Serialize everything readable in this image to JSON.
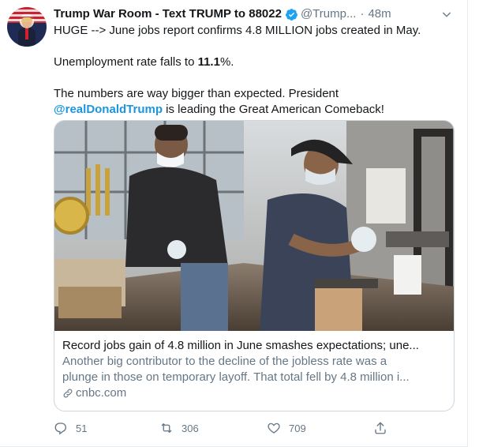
{
  "author": {
    "name": "Trump War Room - Text TRUMP to 88022",
    "handle": "@Trump...",
    "separator": "·",
    "time": "48m"
  },
  "tweet": {
    "line1": "HUGE --> June jobs report confirms 4.8 MILLION jobs created in May.",
    "line2_pre": "Unemployment rate falls to ",
    "line2_bold": "11.1",
    "line2_post": "%.",
    "line3": "The numbers are way bigger than expected. President",
    "line4_mention": "@realDonaldTrump",
    "line4_post": " is leading the Great American Comeback!"
  },
  "card": {
    "title": "Record jobs gain of 4.8 million in June smashes expectations; une...",
    "desc_line1": "Another big contributor to the decline of the jobless rate was a",
    "desc_line2": "plunge in those on temporary layoff. That total fell by 4.8 million i...",
    "domain": "cnbc.com"
  },
  "actions": {
    "replies": "51",
    "retweets": "306",
    "likes": "709"
  },
  "icons": {
    "verified": "verified-badge-icon",
    "more": "chevron-down-icon",
    "reply": "reply-icon",
    "retweet": "retweet-icon",
    "like": "heart-icon",
    "share": "share-icon",
    "link": "link-icon"
  },
  "colors": {
    "link_blue": "#1b95e0",
    "muted": "#657786",
    "text": "#14171a",
    "border": "#ccd6dd"
  }
}
